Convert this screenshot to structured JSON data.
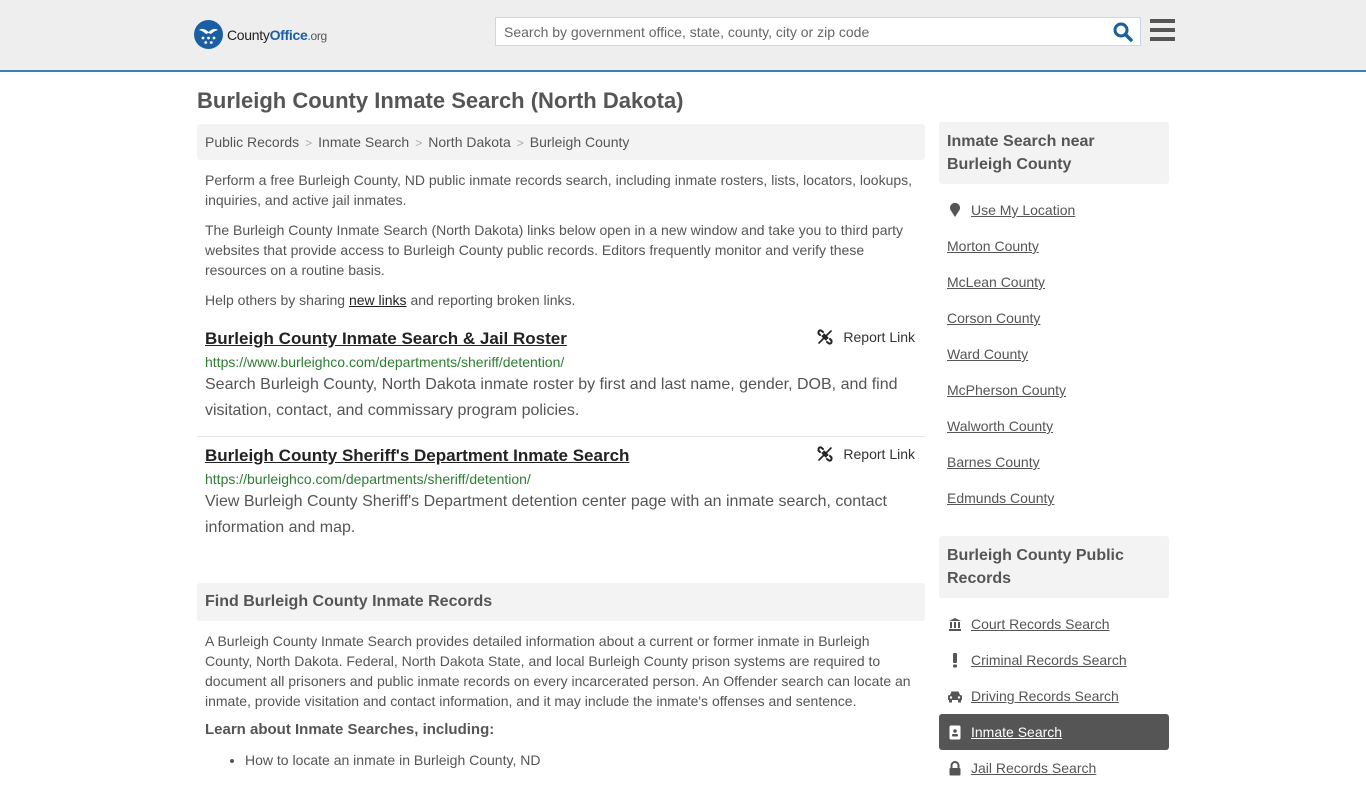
{
  "header": {
    "logo": {
      "county": "County",
      "office": "Office",
      "org": ".org"
    },
    "search": {
      "placeholder": "Search by government office, state, county, city or zip code",
      "value": ""
    },
    "icons": {
      "search": "search-icon",
      "menu": "hamburger-menu-icon"
    }
  },
  "page": {
    "title": "Burleigh County Inmate Search (North Dakota)",
    "breadcrumb": [
      "Public Records",
      "Inmate Search",
      "North Dakota",
      "Burleigh County"
    ],
    "intro": {
      "p1": "Perform a free Burleigh County, ND public inmate records search, including inmate rosters, lists, locators, lookups, inquiries, and active jail inmates.",
      "p2": "The Burleigh County Inmate Search (North Dakota) links below open in a new window and take you to third party websites that provide access to Burleigh County public records. Editors frequently monitor and verify these resources on a routine basis.",
      "p3_before": "Help others by sharing ",
      "p3_link": "new links",
      "p3_after": " and reporting broken links."
    },
    "results": [
      {
        "title": "Burleigh County Inmate Search & Jail Roster",
        "url": "https://www.burleighco.com/departments/sheriff/detention/",
        "description": "Search Burleigh County, North Dakota inmate roster by first and last name, gender, DOB, and find visitation, contact, and commissary program policies.",
        "report_label": "Report Link"
      },
      {
        "title": "Burleigh County Sheriff's Department Inmate Search",
        "url": "https://burleighco.com/departments/sheriff/detention/",
        "description": "View Burleigh County Sheriff's Department detention center page with an inmate search, contact information and map.",
        "report_label": "Report Link"
      }
    ],
    "find_section": {
      "heading": "Find Burleigh County Inmate Records",
      "body": "A Burleigh County Inmate Search provides detailed information about a current or former inmate in Burleigh County, North Dakota. Federal, North Dakota State, and local Burleigh County prison systems are required to document all prisoners and public inmate records on every incarcerated person. An Offender search can locate an inmate, provide visitation and contact information, and it may include the inmate's offenses and sentence.",
      "learn_heading": "Learn about Inmate Searches, including:",
      "learn_items": [
        "How to locate an inmate in Burleigh County, ND"
      ]
    }
  },
  "sidebar": {
    "near": {
      "heading": "Inmate Search near Burleigh County",
      "use_location": "Use My Location",
      "counties": [
        "Morton County",
        "McLean County",
        "Corson County",
        "Ward County",
        "McPherson County",
        "Walworth County",
        "Barnes County",
        "Edmunds County"
      ]
    },
    "public_records": {
      "heading": "Burleigh County Public Records",
      "items": [
        {
          "label": "Court Records Search",
          "icon": "courthouse-icon",
          "active": false
        },
        {
          "label": "Criminal Records Search",
          "icon": "exclamation-icon",
          "active": false
        },
        {
          "label": "Driving Records Search",
          "icon": "car-icon",
          "active": false
        },
        {
          "label": "Inmate Search",
          "icon": "id-badge-icon",
          "active": true
        },
        {
          "label": "Jail Records Search",
          "icon": "lock-icon",
          "active": false
        }
      ]
    }
  },
  "colors": {
    "brand_blue": "#1a5ea3",
    "header_border": "#3a7fb8",
    "url_green": "#2e7d32",
    "active_item_bg": "#555555"
  }
}
